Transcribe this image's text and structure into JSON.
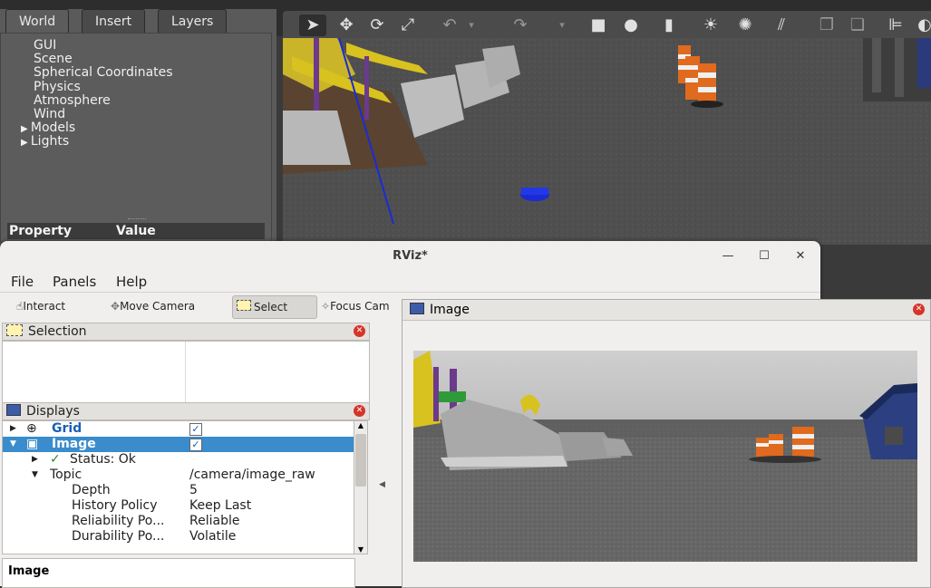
{
  "gazebo": {
    "tabs": [
      "World",
      "Insert",
      "Layers"
    ],
    "tree_items": [
      "GUI",
      "Scene",
      "Spherical Coordinates",
      "Physics",
      "Atmosphere",
      "Wind",
      "Models",
      "Lights"
    ],
    "property_header": "Property",
    "value_header": "Value"
  },
  "rviz": {
    "title": "RViz*",
    "menu": [
      "File",
      "Panels",
      "Help"
    ],
    "tools": [
      "Interact",
      "Move Camera",
      "Select",
      "Focus Cam"
    ],
    "selection_title": "Selection",
    "displays_title": "Displays",
    "displays": [
      {
        "label": "Grid",
        "checked": true
      },
      {
        "label": "Image",
        "checked": true
      },
      {
        "label": "Status: Ok"
      },
      {
        "label": "Topic",
        "value": "/camera/image_raw"
      },
      {
        "label": "Depth",
        "value": "5"
      },
      {
        "label": "History Policy",
        "value": "Keep Last"
      },
      {
        "label": "Reliability Po...",
        "value": "Reliable"
      },
      {
        "label": "Durability Po...",
        "value": "Volatile"
      }
    ],
    "description_title": "Image"
  },
  "image_window": {
    "title": "Image"
  },
  "colors": {
    "selection_blue": "#3a8ccc",
    "close_red": "#d6342a",
    "cone_orange": "#e06a1e"
  }
}
